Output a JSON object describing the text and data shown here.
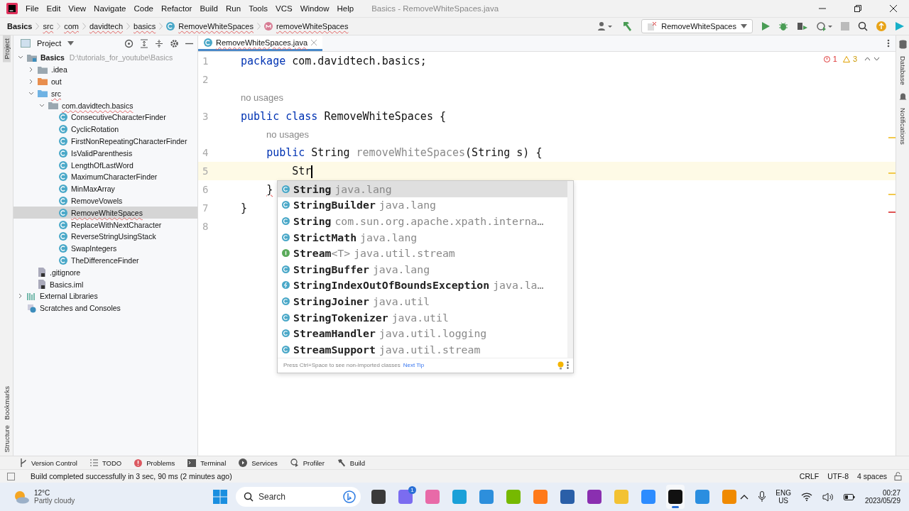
{
  "window": {
    "title": "Basics - RemoveWhiteSpaces.java"
  },
  "menu": [
    "File",
    "Edit",
    "View",
    "Navigate",
    "Code",
    "Refactor",
    "Build",
    "Run",
    "Tools",
    "VCS",
    "Window",
    "Help"
  ],
  "breadcrumbs": [
    {
      "label": "Basics",
      "kind": "project"
    },
    {
      "label": "src",
      "kind": "folder"
    },
    {
      "label": "com",
      "kind": "folder"
    },
    {
      "label": "davidtech",
      "kind": "folder"
    },
    {
      "label": "basics",
      "kind": "folder"
    },
    {
      "label": "RemoveWhiteSpaces",
      "kind": "class"
    },
    {
      "label": "removeWhiteSpaces",
      "kind": "method"
    }
  ],
  "run_config": {
    "label": "RemoveWhiteSpaces"
  },
  "left_stripe": [
    {
      "label": "Project",
      "selected": true
    },
    {
      "label": "Bookmarks",
      "selected": false
    },
    {
      "label": "Structure",
      "selected": false
    }
  ],
  "right_stripe": [
    {
      "label": "Database"
    },
    {
      "label": "Notifications"
    }
  ],
  "project_panel": {
    "title": "Project",
    "tree": [
      {
        "label": "Basics",
        "path": "D:\\tutorials_for_youtube\\Basics",
        "kind": "module",
        "expanded": true,
        "selected": false,
        "children": [
          {
            "label": ".idea",
            "kind": "folder",
            "expanded": false,
            "selected": false
          },
          {
            "label": "out",
            "kind": "excluded",
            "expanded": false,
            "selected": false
          },
          {
            "label": "src",
            "kind": "source",
            "expanded": true,
            "selected": false,
            "children": [
              {
                "label": "com.davidtech.basics",
                "kind": "package",
                "expanded": true,
                "selected": false,
                "children": [
                  {
                    "label": "ConsecutiveCharacterFinder",
                    "kind": "class",
                    "selected": false
                  },
                  {
                    "label": "CyclicRotation",
                    "kind": "class",
                    "selected": false
                  },
                  {
                    "label": "FirstNonRepeatingCharacterFinder",
                    "kind": "class",
                    "selected": false
                  },
                  {
                    "label": "IsValidParenthesis",
                    "kind": "class",
                    "selected": false
                  },
                  {
                    "label": "LengthOfLastWord",
                    "kind": "class",
                    "selected": false
                  },
                  {
                    "label": "MaximumCharacterFinder",
                    "kind": "class",
                    "selected": false
                  },
                  {
                    "label": "MinMaxArray",
                    "kind": "class",
                    "selected": false
                  },
                  {
                    "label": "RemoveVowels",
                    "kind": "class",
                    "selected": false
                  },
                  {
                    "label": "RemoveWhiteSpaces",
                    "kind": "class",
                    "selected": true
                  },
                  {
                    "label": "ReplaceWithNextCharacter",
                    "kind": "class",
                    "selected": false
                  },
                  {
                    "label": "ReverseStringUsingStack",
                    "kind": "class",
                    "selected": false
                  },
                  {
                    "label": "SwapIntegers",
                    "kind": "class",
                    "selected": false
                  },
                  {
                    "label": "TheDifferenceFinder",
                    "kind": "class",
                    "selected": false
                  }
                ]
              }
            ]
          },
          {
            "label": ".gitignore",
            "kind": "file",
            "selected": false
          },
          {
            "label": "Basics.iml",
            "kind": "file",
            "selected": false
          }
        ]
      },
      {
        "label": "External Libraries",
        "kind": "libraries",
        "expanded": false,
        "selected": false
      },
      {
        "label": "Scratches and Consoles",
        "kind": "scratches",
        "selected": false
      }
    ]
  },
  "editor": {
    "tab": {
      "label": "RemoveWhiteSpaces.java",
      "selected": true
    },
    "errors": "1",
    "warnings": "3",
    "lines": [
      {
        "kind": "code",
        "number": "1",
        "current": false,
        "tokens": [
          {
            "text": "package",
            "kind": "keyword"
          },
          {
            "text": " com.davidtech.basics;",
            "kind": "plain"
          }
        ]
      },
      {
        "kind": "code",
        "number": "2",
        "current": false
      },
      {
        "kind": "inlay",
        "text": "no usages"
      },
      {
        "kind": "code",
        "number": "3",
        "current": false,
        "tokens": [
          {
            "text": "public class",
            "kind": "keyword"
          },
          {
            "text": " RemoveWhiteSpaces {",
            "kind": "plain"
          }
        ]
      },
      {
        "kind": "inlay",
        "text": "no usages"
      },
      {
        "kind": "code",
        "number": "4",
        "current": false,
        "tokens": [
          {
            "text": "    public",
            "kind": "keyword"
          },
          {
            "text": " String ",
            "kind": "plain"
          },
          {
            "text": "removeWhiteSpaces",
            "kind": "unused"
          },
          {
            "text": "(String s) {",
            "kind": "plain"
          }
        ]
      },
      {
        "kind": "code",
        "number": "5",
        "current": true,
        "tokens": [
          {
            "text": "        Str",
            "kind": "plain"
          }
        ]
      },
      {
        "kind": "code",
        "number": "6",
        "current": false,
        "tokens": [
          {
            "text": "    }",
            "kind": "error"
          }
        ]
      },
      {
        "kind": "code",
        "number": "7",
        "current": false,
        "tokens": [
          {
            "text": "}",
            "kind": "plain"
          }
        ]
      },
      {
        "kind": "code",
        "number": "8",
        "current": false
      }
    ],
    "completion": {
      "items": [
        {
          "kind": "class",
          "name": "String",
          "detail": "java.lang",
          "selected": true
        },
        {
          "kind": "class",
          "name": "StringBuilder",
          "detail": "java.lang",
          "selected": false
        },
        {
          "kind": "class",
          "name": "String",
          "detail": "com.sun.org.apache.xpath.interna…",
          "selected": false
        },
        {
          "kind": "class",
          "name": "StrictMath",
          "detail": "java.lang",
          "selected": false
        },
        {
          "kind": "interface",
          "name": "Stream",
          "generic": "<T>",
          "detail": "java.util.stream",
          "selected": false
        },
        {
          "kind": "class",
          "name": "StringBuffer",
          "detail": "java.lang",
          "selected": false
        },
        {
          "kind": "exception",
          "name": "StringIndexOutOfBoundsException",
          "detail": "java.la…",
          "selected": false
        },
        {
          "kind": "class",
          "name": "StringJoiner",
          "detail": "java.util",
          "selected": false
        },
        {
          "kind": "class",
          "name": "StringTokenizer",
          "detail": "java.util",
          "selected": false
        },
        {
          "kind": "class",
          "name": "StreamHandler",
          "detail": "java.util.logging",
          "selected": false
        },
        {
          "kind": "class",
          "name": "StreamSupport",
          "detail": "java.util.stream",
          "selected": false
        }
      ],
      "hint": "Press Ctrl+Space to see non-imported classes",
      "hint_link": "Next Tip"
    }
  },
  "tool_windows": [
    {
      "label": "Version Control",
      "kind": "vcs"
    },
    {
      "label": "TODO",
      "kind": "list"
    },
    {
      "label": "Problems",
      "kind": "problems"
    },
    {
      "label": "Terminal",
      "kind": "terminal"
    },
    {
      "label": "Services",
      "kind": "services"
    },
    {
      "label": "Profiler",
      "kind": "profiler"
    },
    {
      "label": "Build",
      "kind": "build"
    }
  ],
  "status_bar": {
    "message": "Build completed successfully in 3 sec, 90 ms (2 minutes ago)",
    "items": [
      "CRLF",
      "UTF-8",
      "4 spaces"
    ]
  },
  "taskbar": {
    "temperature": "12°C",
    "weather": "Partly cloudy",
    "search": {
      "placeholder": "Search"
    },
    "apps": [
      {
        "kind": "explorer",
        "active": false
      },
      {
        "kind": "chat",
        "badge": "1",
        "active": false
      },
      {
        "kind": "paint",
        "active": false
      },
      {
        "kind": "edge",
        "active": false
      },
      {
        "kind": "mail",
        "active": false
      },
      {
        "kind": "nvidia",
        "active": false
      },
      {
        "kind": "firefox",
        "active": false
      },
      {
        "kind": "store",
        "active": false
      },
      {
        "kind": "mask",
        "active": false
      },
      {
        "kind": "folder",
        "active": false
      },
      {
        "kind": "zoom",
        "active": false
      },
      {
        "kind": "ide",
        "active": true
      },
      {
        "kind": "vscode",
        "active": false
      },
      {
        "kind": "vlc",
        "active": false
      }
    ],
    "language": "ENG",
    "region": "US",
    "time": "00:27",
    "date": "2023/05/29"
  }
}
